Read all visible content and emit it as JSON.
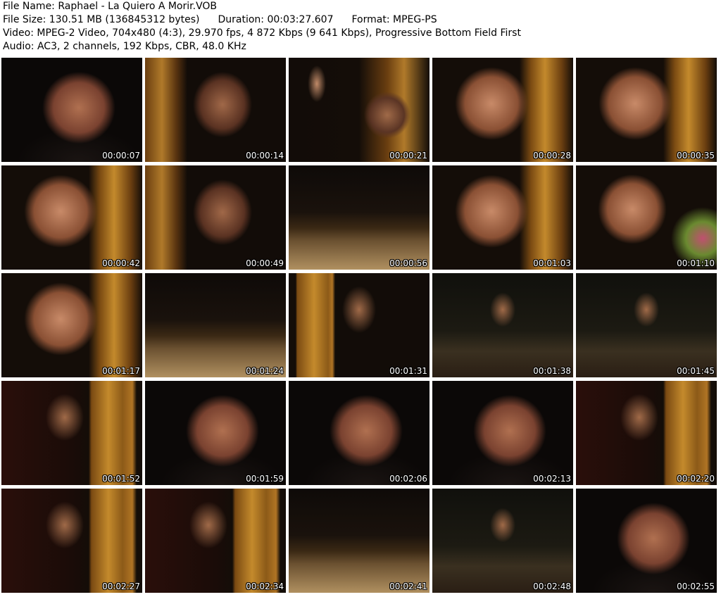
{
  "info": {
    "file_name": "File Name: Raphael - La Quiero A Morir.VOB",
    "file_size": "File Size: 130.51 MB (136845312 bytes)",
    "duration": "Duration: 00:03:27.607",
    "format": "Format: MPEG-PS",
    "video": "Video: MPEG-2 Video, 704x480 (4:3), 29.970 fps, 4 872 Kbps (9 641 Kbps), Progressive Bottom Field First",
    "audio": "Audio: AC3, 2 channels, 192 Kbps, CBR, 48.0 KHz"
  },
  "thumbnails": [
    {
      "time": "00:00:07",
      "scene": "closeup-dark"
    },
    {
      "time": "00:00:14",
      "scene": "mic-curtain"
    },
    {
      "time": "00:00:21",
      "scene": "hand-raised"
    },
    {
      "time": "00:00:28",
      "scene": "face-curtain"
    },
    {
      "time": "00:00:35",
      "scene": "face-curtain"
    },
    {
      "time": "00:00:42",
      "scene": "face-curtain"
    },
    {
      "time": "00:00:49",
      "scene": "mic-curtain"
    },
    {
      "time": "00:00:56",
      "scene": "stage-wide"
    },
    {
      "time": "00:01:03",
      "scene": "face-curtain"
    },
    {
      "time": "00:01:10",
      "scene": "face-flare"
    },
    {
      "time": "00:01:17",
      "scene": "face-curtain"
    },
    {
      "time": "00:01:24",
      "scene": "stage-wide"
    },
    {
      "time": "00:01:31",
      "scene": "curtain-left"
    },
    {
      "time": "00:01:38",
      "scene": "stage-audience"
    },
    {
      "time": "00:01:45",
      "scene": "stage-audience"
    },
    {
      "time": "00:01:52",
      "scene": "curtain-right"
    },
    {
      "time": "00:01:59",
      "scene": "closeup-dark"
    },
    {
      "time": "00:02:06",
      "scene": "closeup-dark"
    },
    {
      "time": "00:02:13",
      "scene": "closeup-dark"
    },
    {
      "time": "00:02:20",
      "scene": "curtain-right"
    },
    {
      "time": "00:02:27",
      "scene": "curtain-right"
    },
    {
      "time": "00:02:34",
      "scene": "curtain-right"
    },
    {
      "time": "00:02:41",
      "scene": "stage-wide"
    },
    {
      "time": "00:02:48",
      "scene": "stage-audience"
    },
    {
      "time": "00:02:55",
      "scene": "closeup-dark"
    }
  ]
}
